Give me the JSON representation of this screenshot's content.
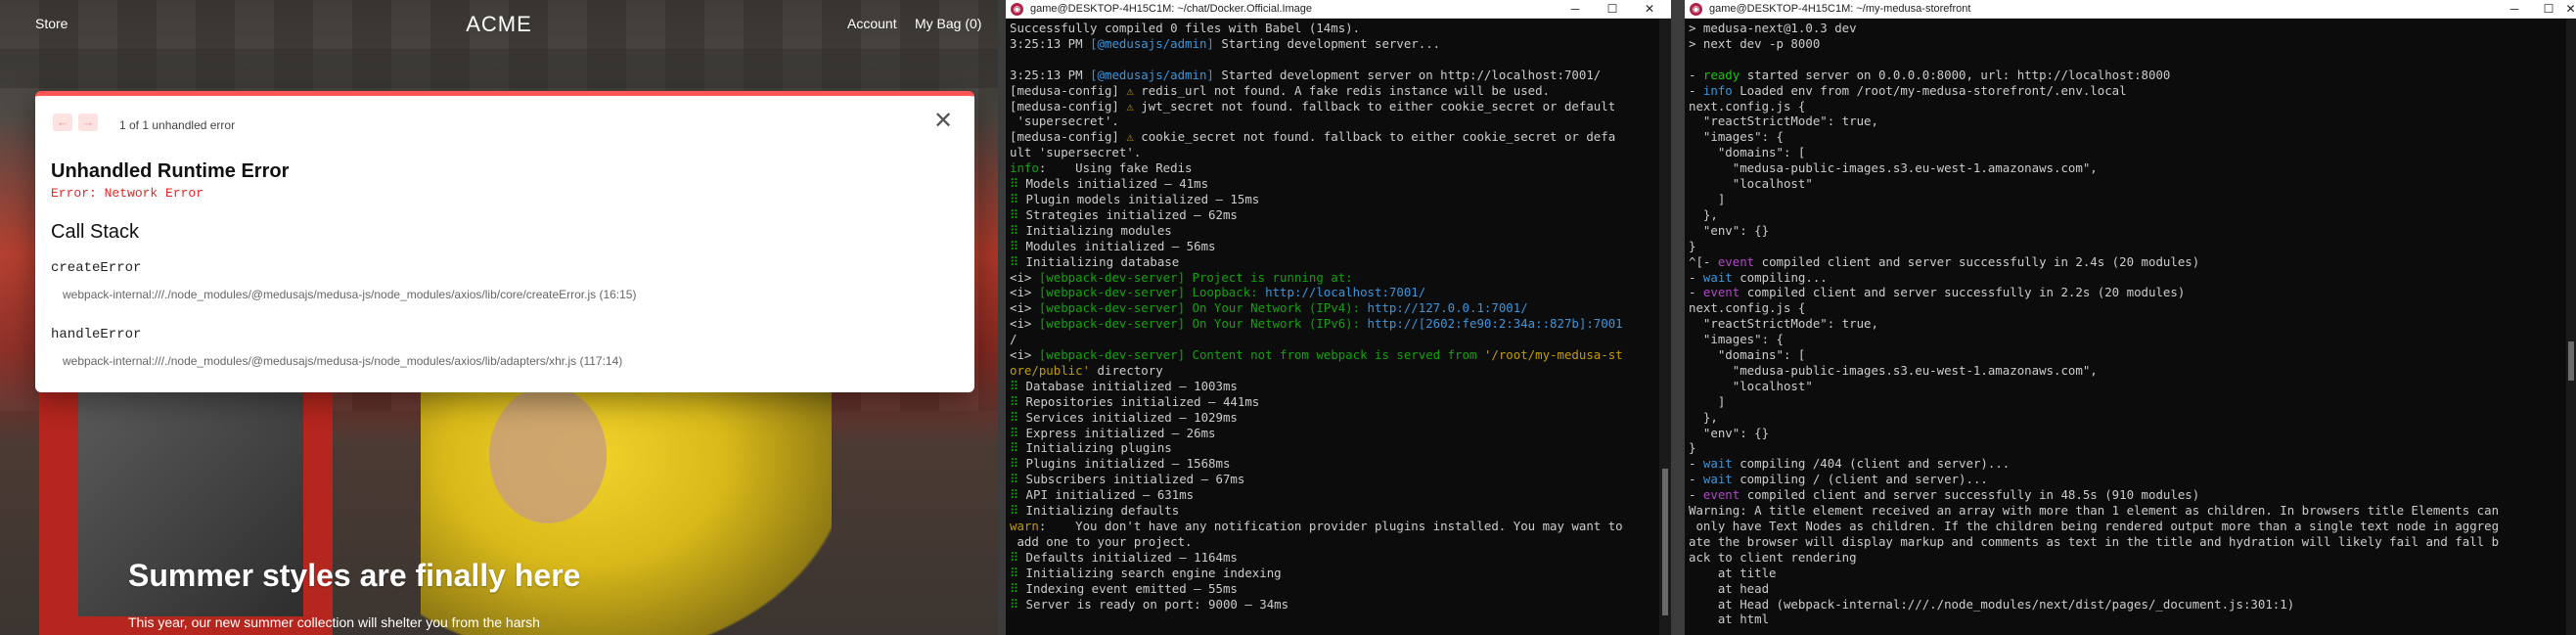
{
  "browser": {
    "nav": {
      "store": "Store",
      "logo": "ACME",
      "account": "Account",
      "bag": "My Bag (0)"
    },
    "hero": {
      "title": "Summer styles are finally here",
      "subtitle": "This year, our new summer collection will shelter you from the harsh"
    },
    "error_modal": {
      "count": "1 of 1 unhandled error",
      "title": "Unhandled Runtime Error",
      "error": "Error: Network Error",
      "stack_heading": "Call Stack",
      "frames": [
        {
          "fn": "createError",
          "path": "webpack-internal:///./node_modules/@medusajs/medusa-js/node_modules/axios/lib/core/createError.js (16:15)"
        },
        {
          "fn": "handleError",
          "path": "webpack-internal:///./node_modules/@medusajs/medusa-js/node_modules/axios/lib/adapters/xhr.js (117:14)"
        }
      ]
    }
  },
  "terminal1": {
    "title": "game@DESKTOP-4H15C1M: ~/chat/Docker.Official.Image",
    "lines": [
      [
        [
          "Successfully compiled 0 files with Babel (14ms).",
          ""
        ]
      ],
      [
        [
          "3:25:13 PM ",
          ""
        ],
        [
          "[@medusajs/admin]",
          "c"
        ],
        [
          " Starting development server...",
          ""
        ]
      ],
      [
        [
          "",
          ""
        ]
      ],
      [
        [
          "3:25:13 PM ",
          ""
        ],
        [
          "[@medusajs/admin]",
          "c"
        ],
        [
          " Started development server on http://localhost:7001/",
          ""
        ]
      ],
      [
        [
          "[medusa-config] ",
          ""
        ],
        [
          "⚠",
          "y"
        ],
        [
          " redis_url not found. A fake redis instance will be used.",
          ""
        ]
      ],
      [
        [
          "[medusa-config] ",
          ""
        ],
        [
          "⚠",
          "y"
        ],
        [
          " jwt_secret not found. fallback to either cookie_secret or default",
          ""
        ]
      ],
      [
        [
          " 'supersecret'.",
          ""
        ]
      ],
      [
        [
          "[medusa-config] ",
          ""
        ],
        [
          "⚠",
          "y"
        ],
        [
          " cookie_secret not found. fallback to either cookie_secret or defa",
          ""
        ]
      ],
      [
        [
          "ult 'supersecret'.",
          ""
        ]
      ],
      [
        [
          "info",
          "g"
        ],
        [
          ":    Using fake Redis",
          ""
        ]
      ],
      [
        [
          "⠿",
          "g"
        ],
        [
          " Models initialized – 41ms",
          ""
        ]
      ],
      [
        [
          "⠿",
          "g"
        ],
        [
          " Plugin models initialized – 15ms",
          ""
        ]
      ],
      [
        [
          "⠿",
          "g"
        ],
        [
          " Strategies initialized – 62ms",
          ""
        ]
      ],
      [
        [
          "⠿",
          "g"
        ],
        [
          " Initializing modules",
          ""
        ]
      ],
      [
        [
          "⠿",
          "g"
        ],
        [
          " Modules initialized – 56ms",
          ""
        ]
      ],
      [
        [
          "⠿",
          "g"
        ],
        [
          " Initializing database",
          ""
        ]
      ],
      [
        [
          "<i> ",
          ""
        ],
        [
          "[webpack-dev-server] Project is running at:",
          "g"
        ]
      ],
      [
        [
          "<i> ",
          ""
        ],
        [
          "[webpack-dev-server] Loopback: ",
          "g"
        ],
        [
          "http://localhost:7001/",
          "c"
        ]
      ],
      [
        [
          "<i> ",
          ""
        ],
        [
          "[webpack-dev-server] On Your Network (IPv4): ",
          "g"
        ],
        [
          "http://127.0.0.1:7001/",
          "c"
        ]
      ],
      [
        [
          "<i> ",
          ""
        ],
        [
          "[webpack-dev-server] On Your Network (IPv6): ",
          "g"
        ],
        [
          "http://[2602:fe90:2:34a::827b]:7001",
          "c"
        ]
      ],
      [
        [
          "/",
          ""
        ]
      ],
      [
        [
          "<i> ",
          ""
        ],
        [
          "[webpack-dev-server] Content not from webpack is served from ",
          "g"
        ],
        [
          "'/root/my-medusa-st",
          "y"
        ]
      ],
      [
        [
          "ore/public'",
          "y"
        ],
        [
          " directory",
          ""
        ]
      ],
      [
        [
          "⠿",
          "g"
        ],
        [
          " Database initialized – 1003ms",
          ""
        ]
      ],
      [
        [
          "⠿",
          "g"
        ],
        [
          " Repositories initialized – 441ms",
          ""
        ]
      ],
      [
        [
          "⠿",
          "g"
        ],
        [
          " Services initialized – 1029ms",
          ""
        ]
      ],
      [
        [
          "⠿",
          "g"
        ],
        [
          " Express initialized – 26ms",
          ""
        ]
      ],
      [
        [
          "⠿",
          "g"
        ],
        [
          " Initializing plugins",
          ""
        ]
      ],
      [
        [
          "⠿",
          "g"
        ],
        [
          " Plugins initialized – 1568ms",
          ""
        ]
      ],
      [
        [
          "⠿",
          "g"
        ],
        [
          " Subscribers initialized – 67ms",
          ""
        ]
      ],
      [
        [
          "⠿",
          "g"
        ],
        [
          " API initialized – 631ms",
          ""
        ]
      ],
      [
        [
          "⠿",
          "g"
        ],
        [
          " Initializing defaults",
          ""
        ]
      ],
      [
        [
          "warn",
          "y"
        ],
        [
          ":    You don't have any notification provider plugins installed. You may want to",
          ""
        ]
      ],
      [
        [
          " add one to your project.",
          ""
        ]
      ],
      [
        [
          "⠿",
          "g"
        ],
        [
          " Defaults initialized – 1164ms",
          ""
        ]
      ],
      [
        [
          "⠿",
          "g"
        ],
        [
          " Initializing search engine indexing",
          ""
        ]
      ],
      [
        [
          "⠿",
          "g"
        ],
        [
          " Indexing event emitted – 55ms",
          ""
        ]
      ],
      [
        [
          "⠿",
          "g"
        ],
        [
          " Server is ready on port: 9000 – 34ms",
          ""
        ]
      ]
    ]
  },
  "terminal2": {
    "title": "game@DESKTOP-4H15C1M: ~/my-medusa-storefront",
    "lines": [
      [
        [
          "> medusa-next@1.0.3 dev",
          ""
        ]
      ],
      [
        [
          "> next dev -p 8000",
          ""
        ]
      ],
      [
        [
          "",
          ""
        ]
      ],
      [
        [
          "- ",
          ""
        ],
        [
          "ready",
          "gb"
        ],
        [
          " started server on 0.0.0.0:8000, url: http://localhost:8000",
          ""
        ]
      ],
      [
        [
          "- ",
          ""
        ],
        [
          "info",
          "c"
        ],
        [
          " Loaded env from /root/my-medusa-storefront/.env.local",
          ""
        ]
      ],
      [
        [
          "next.config.js {",
          ""
        ]
      ],
      [
        [
          "  \"reactStrictMode\": true,",
          ""
        ]
      ],
      [
        [
          "  \"images\": {",
          ""
        ]
      ],
      [
        [
          "    \"domains\": [",
          ""
        ]
      ],
      [
        [
          "      \"medusa-public-images.s3.eu-west-1.amazonaws.com\",",
          ""
        ]
      ],
      [
        [
          "      \"localhost\"",
          ""
        ]
      ],
      [
        [
          "    ]",
          ""
        ]
      ],
      [
        [
          "  },",
          ""
        ]
      ],
      [
        [
          "  \"env\": {}",
          ""
        ]
      ],
      [
        [
          "}",
          ""
        ]
      ],
      [
        [
          "^[- ",
          ""
        ],
        [
          "event",
          "m"
        ],
        [
          " compiled client and server successfully in 2.4s (20 modules)",
          ""
        ]
      ],
      [
        [
          "- ",
          ""
        ],
        [
          "wait",
          "c"
        ],
        [
          " compiling...",
          ""
        ]
      ],
      [
        [
          "- ",
          ""
        ],
        [
          "event",
          "m"
        ],
        [
          " compiled client and server successfully in 2.2s (20 modules)",
          ""
        ]
      ],
      [
        [
          "next.config.js {",
          ""
        ]
      ],
      [
        [
          "  \"reactStrictMode\": true,",
          ""
        ]
      ],
      [
        [
          "  \"images\": {",
          ""
        ]
      ],
      [
        [
          "    \"domains\": [",
          ""
        ]
      ],
      [
        [
          "      \"medusa-public-images.s3.eu-west-1.amazonaws.com\",",
          ""
        ]
      ],
      [
        [
          "      \"localhost\"",
          ""
        ]
      ],
      [
        [
          "    ]",
          ""
        ]
      ],
      [
        [
          "  },",
          ""
        ]
      ],
      [
        [
          "  \"env\": {}",
          ""
        ]
      ],
      [
        [
          "}",
          ""
        ]
      ],
      [
        [
          "- ",
          ""
        ],
        [
          "wait",
          "c"
        ],
        [
          " compiling /404 (client and server)...",
          ""
        ]
      ],
      [
        [
          "- ",
          ""
        ],
        [
          "wait",
          "c"
        ],
        [
          " compiling / (client and server)...",
          ""
        ]
      ],
      [
        [
          "- ",
          ""
        ],
        [
          "event",
          "m"
        ],
        [
          " compiled client and server successfully in 48.5s (910 modules)",
          ""
        ]
      ],
      [
        [
          "Warning: A title element received an array with more than 1 element as children. In browsers title Elements can",
          ""
        ]
      ],
      [
        [
          " only have Text Nodes as children. If the children being rendered output more than a single text node in aggreg",
          ""
        ]
      ],
      [
        [
          "ate the browser will display markup and comments as text in the title and hydration will likely fail and fall b",
          ""
        ]
      ],
      [
        [
          "ack to client rendering",
          ""
        ]
      ],
      [
        [
          "    at title",
          ""
        ]
      ],
      [
        [
          "    at head",
          ""
        ]
      ],
      [
        [
          "    at Head (webpack-internal:///./node_modules/next/dist/pages/_document.js:301:1)",
          ""
        ]
      ],
      [
        [
          "    at html",
          ""
        ]
      ]
    ]
  },
  "window_controls": {
    "minimize": "─",
    "maximize": "☐",
    "close": "✕"
  }
}
